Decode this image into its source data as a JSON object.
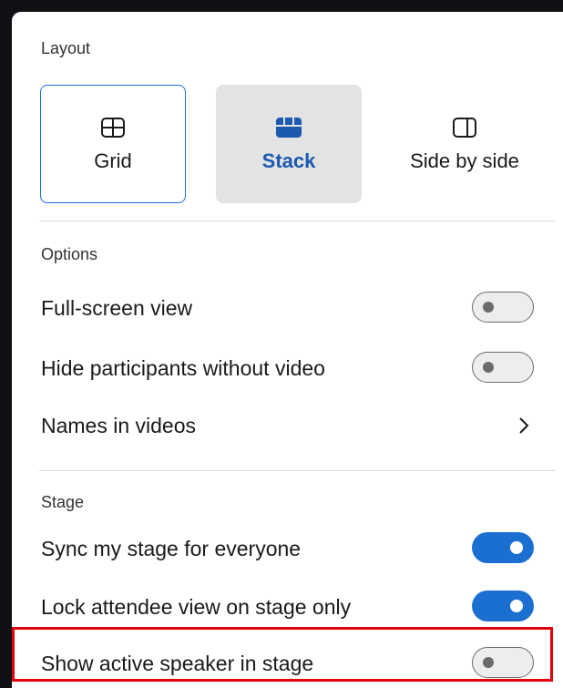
{
  "layout": {
    "title": "Layout",
    "options": [
      {
        "label": "Grid",
        "icon": "grid-icon",
        "selected": false
      },
      {
        "label": "Stack",
        "icon": "stack-icon",
        "selected": true
      },
      {
        "label": "Side by side",
        "icon": "side-by-side-icon",
        "selected": false
      }
    ]
  },
  "options": {
    "title": "Options",
    "full_screen": {
      "label": "Full-screen view",
      "on": false
    },
    "hide_participants": {
      "label": "Hide participants without video",
      "on": false
    },
    "names_in_videos": {
      "label": "Names in videos",
      "icon": "chevron-right-icon"
    }
  },
  "stage": {
    "title": "Stage",
    "sync": {
      "label": "Sync my stage for everyone",
      "on": true
    },
    "lock_attendee": {
      "label": "Lock attendee view on stage only",
      "on": true
    },
    "show_active_speaker": {
      "label": "Show active speaker in stage",
      "on": false,
      "highlighted": true
    }
  },
  "colors": {
    "accent": "#1b6fd1",
    "highlight": "#e5000a",
    "background": "#0f1115"
  }
}
